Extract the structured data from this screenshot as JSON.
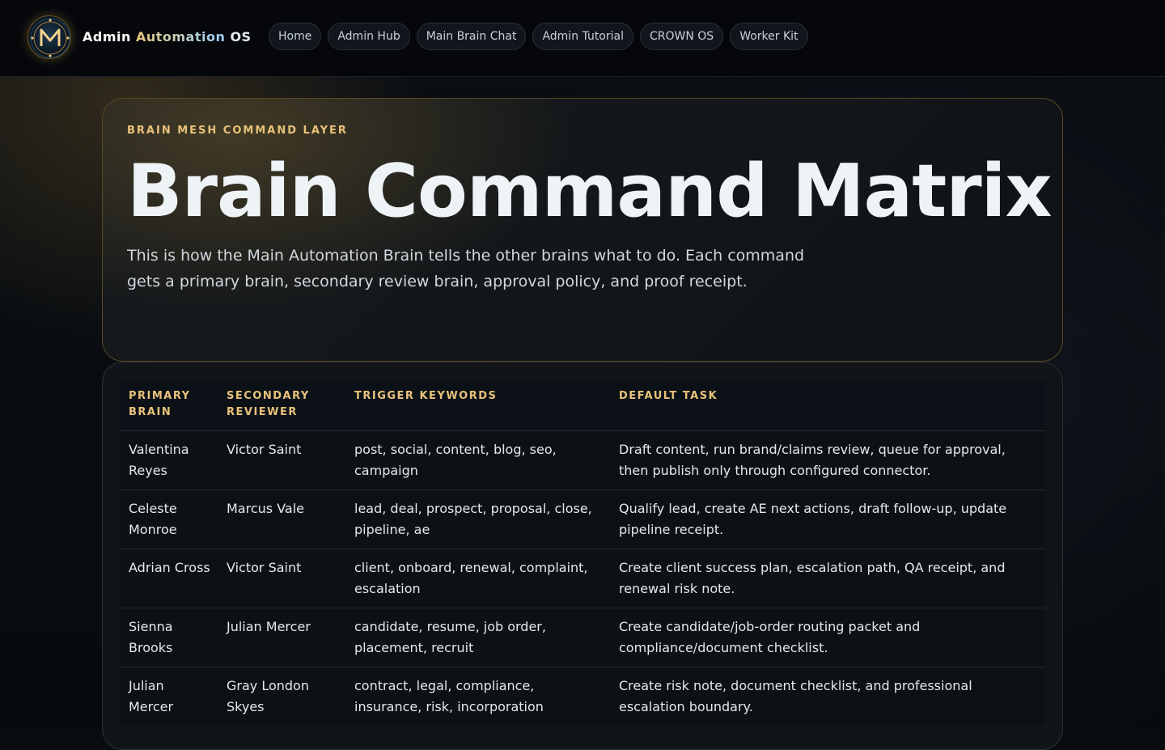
{
  "brand": {
    "part1": "Admin",
    "part2": "Automation",
    "part3": "OS"
  },
  "nav": {
    "items": [
      {
        "label": "Home"
      },
      {
        "label": "Admin Hub"
      },
      {
        "label": "Main Brain Chat"
      },
      {
        "label": "Admin Tutorial"
      },
      {
        "label": "CROWN OS"
      },
      {
        "label": "Worker Kit"
      }
    ]
  },
  "hero": {
    "eyebrow": "BRAIN MESH COMMAND LAYER",
    "title": "Brain Command Matrix",
    "description": "This is how the Main Automation Brain tells the other brains what to do. Each command gets a primary brain, secondary review brain, approval policy, and proof receipt."
  },
  "table": {
    "headers": [
      "PRIMARY BRAIN",
      "SECONDARY REVIEWER",
      "TRIGGER KEYWORDS",
      "DEFAULT TASK"
    ],
    "rows": [
      [
        "Valentina Reyes",
        "Victor Saint",
        "post, social, content, blog, seo, campaign",
        "Draft content, run brand/claims review, queue for approval, then publish only through configured connector."
      ],
      [
        "Celeste Monroe",
        "Marcus Vale",
        "lead, deal, prospect, proposal, close, pipeline, ae",
        "Qualify lead, create AE next actions, draft follow-up, update pipeline receipt."
      ],
      [
        "Adrian Cross",
        "Victor Saint",
        "client, onboard, renewal, complaint, escalation",
        "Create client success plan, escalation path, QA receipt, and renewal risk note."
      ],
      [
        "Sienna Brooks",
        "Julian Mercer",
        "candidate, resume, job order, placement, recruit",
        "Create candidate/job-order routing packet and compliance/document checklist."
      ],
      [
        "Julian Mercer",
        "Gray London Skyes",
        "contract, legal, compliance, insurance, risk, incorporation",
        "Create risk note, document checklist, and professional escalation boundary."
      ]
    ]
  },
  "colors": {
    "accent_gold": "#e8c27a",
    "background": "#080b10",
    "panel": "#11151a"
  }
}
